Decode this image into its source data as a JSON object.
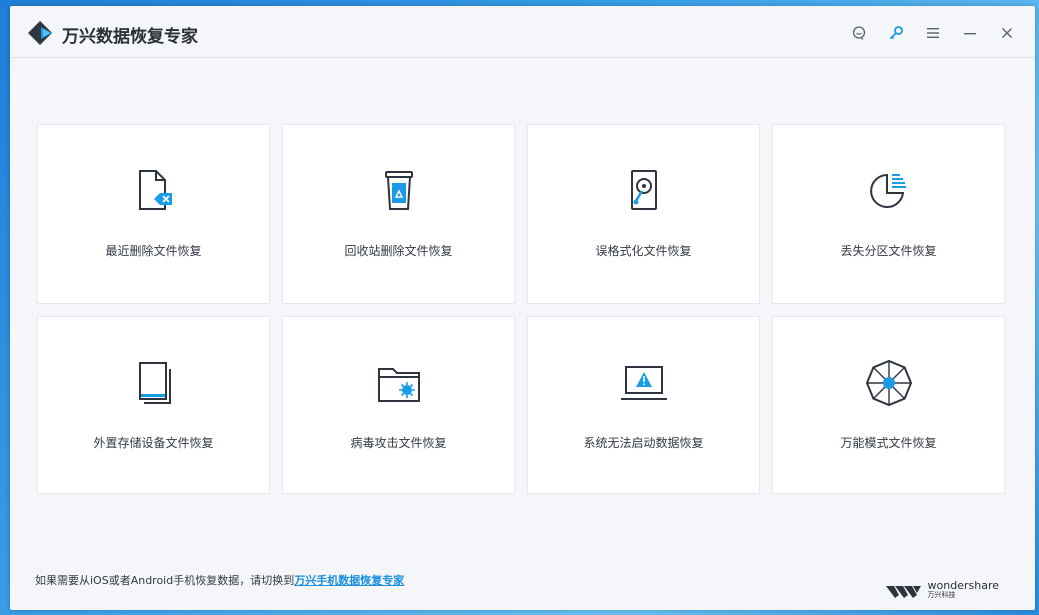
{
  "app": {
    "title": "万兴数据恢复专家"
  },
  "titlebar": {
    "buttons": [
      {
        "name": "feedback-icon"
      },
      {
        "name": "key-icon"
      },
      {
        "name": "menu-icon"
      },
      {
        "name": "minimize-icon"
      },
      {
        "name": "close-icon"
      }
    ]
  },
  "modes": [
    {
      "label": "最近删除文件恢复",
      "icon": "deleted-file-icon"
    },
    {
      "label": "回收站删除文件恢复",
      "icon": "recycle-bin-icon"
    },
    {
      "label": "误格式化文件恢复",
      "icon": "hard-drive-icon"
    },
    {
      "label": "丢失分区文件恢复",
      "icon": "partition-icon"
    },
    {
      "label": "外置存储设备文件恢复",
      "icon": "external-storage-icon"
    },
    {
      "label": "病毒攻击文件恢复",
      "icon": "virus-folder-icon"
    },
    {
      "label": "系统无法启动数据恢复",
      "icon": "laptop-warning-icon"
    },
    {
      "label": "万能模式文件恢复",
      "icon": "all-around-icon"
    }
  ],
  "footer": {
    "prefix": "如果需要从iOS或者Android手机恢复数据，请切换到",
    "link": "万兴手机数据恢复专家"
  },
  "brand": {
    "name": "wondershare",
    "sub": "万兴科技"
  },
  "colors": {
    "accent": "#1a9be8",
    "icon_stroke": "#2f3540"
  }
}
